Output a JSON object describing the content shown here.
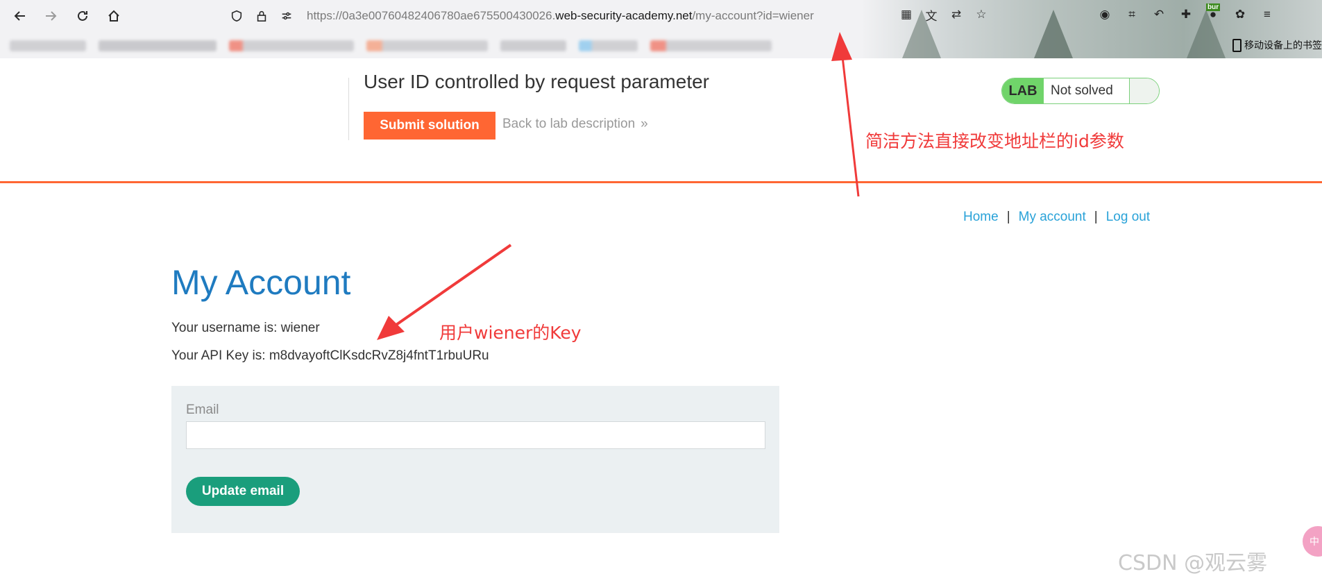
{
  "browser": {
    "url_prefix": "https://0a3e00760482406780ae675500430026.",
    "url_host": "web-security-academy.net",
    "url_path": "/my-account?id=wiener",
    "mobile_bookmarks": "移动设备上的书签",
    "burp_ext_label": "bur"
  },
  "lab": {
    "title": "User ID controlled by request parameter",
    "submit_label": "Submit solution",
    "back_label": "Back to lab description",
    "back_arrow": "»",
    "badge_label": "LAB",
    "status": "Not solved"
  },
  "nav": {
    "home": "Home",
    "separator": "|",
    "my_account": "My account",
    "log_out": "Log out"
  },
  "account": {
    "heading": "My Account",
    "username_line": "Your username is: wiener",
    "api_key_line": "Your API Key is: m8dvayoftClKsdcRvZ8j4fntT1rbuURu",
    "email_label": "Email",
    "email_value": "",
    "update_label": "Update email"
  },
  "annotations": {
    "url_note": "简洁方法直接改变地址栏的id参数",
    "key_note": "用户wiener的Key",
    "watermark": "CSDN @观云雾",
    "side_badge": "中"
  },
  "colors": {
    "accent_orange": "#ff6633",
    "link_blue": "#29a2d8",
    "heading_blue": "#1f7bc0",
    "button_green": "#1a9e7c",
    "annotation_red": "#f03a3a"
  }
}
